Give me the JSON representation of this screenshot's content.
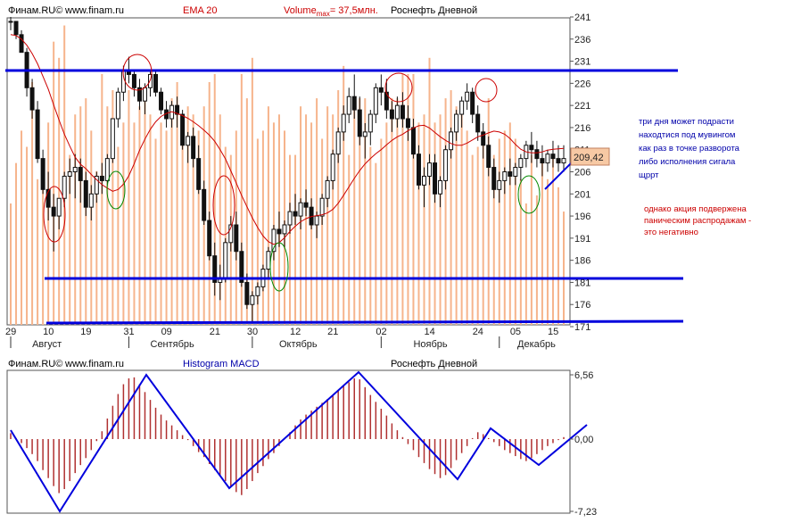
{
  "price_header": {
    "source": "Финам.RU©",
    "site": "www.finam.ru",
    "indicator": "EMA 20",
    "volume_prefix": "Volume",
    "volume_sub": "max",
    "volume_suffix": "= 37,5млн.",
    "instrument": "Роснефть Дневной"
  },
  "macd_header": {
    "source": "Финам.RU©",
    "site": "www.finam.ru",
    "indicator": "Histogram MACD",
    "instrument": "Роснефть Дневной"
  },
  "notes": {
    "blue_lines": [
      "три дня может подрасти",
      "находтися под мувингом",
      "как раз в точке разворота",
      "либо исполнения сигала",
      "щррт"
    ],
    "red_lines": [
      "однако акция подвержена",
      "паническим распродажам -",
      "это негативно"
    ]
  },
  "colors": {
    "candle": "#111111",
    "ema": "#cc0000",
    "volume": "#f6b48c",
    "macd_bar": "#b03030",
    "trend_line": "#0000dd",
    "ellipse_red": "#cc0000",
    "ellipse_green": "#008800",
    "last_price_bg": "#f7c9a4",
    "note_blue": "#0000aa",
    "note_red": "#cc0000"
  },
  "chart_data": [
    {
      "type": "candlestick",
      "title": "Роснефть Дневной",
      "ylim": [
        171,
        241
      ],
      "y_ticks": [
        "241",
        "236",
        "231",
        "226",
        "221",
        "216",
        "211",
        "206",
        "201",
        "196",
        "191",
        "186",
        "181",
        "176",
        "171"
      ],
      "x_ticks": [
        "29",
        "10",
        "19",
        "31",
        "09",
        "21",
        "30",
        "12",
        "21",
        "02",
        "14",
        "24",
        "05",
        "15"
      ],
      "months": [
        "Август",
        "Сентябрь",
        "Октябрь",
        "Ноябрь",
        "Декабрь"
      ],
      "last_price": "209,42",
      "series": [
        {
          "name": "EMA 20",
          "values": [
            237.0,
            236.8,
            236.0,
            234.6,
            232.7,
            230.4,
            227.6,
            224.7,
            221.1,
            217.7,
            214.5,
            211.8,
            209.3,
            207.7,
            206.7,
            205.4,
            204.2,
            203.1,
            202.3,
            201.6,
            202.0,
            203.2,
            205.1,
            207.8,
            210.9,
            213.4,
            215.6,
            217.3,
            218.5,
            219.2,
            219.6,
            219.2,
            218.7,
            218.1,
            217.3,
            216.4,
            215.4,
            214.3,
            212.9,
            211.0,
            208.9,
            206.2,
            203.5,
            200.7,
            198.1,
            195.6,
            193.4,
            191.5,
            190.2,
            189.6,
            190.0,
            191.1,
            192.5,
            193.7,
            194.7,
            195.4,
            195.9,
            196.1,
            196.3,
            196.7,
            197.5,
            198.9,
            200.7,
            202.6,
            204.5,
            206.3,
            207.8,
            209.0,
            210.1,
            211.0,
            212.1,
            213.1,
            213.9,
            214.5,
            215.3,
            215.9,
            216.4,
            216.5,
            215.9,
            214.9,
            213.9,
            213.1,
            212.4,
            212.0,
            212.0,
            212.5,
            213.2,
            213.9,
            214.3,
            214.8,
            215.2,
            215.0,
            214.5,
            213.5,
            212.2,
            211.1,
            210.5,
            210.3,
            210.3,
            210.5,
            210.9,
            211.1,
            211.2,
            211.3
          ]
        },
        {
          "name": "Volume",
          "values": [
            15,
            20,
            24,
            22,
            30,
            18,
            17,
            25,
            35,
            33,
            37,
            21,
            26,
            27,
            28,
            24,
            19,
            31,
            27,
            29,
            22,
            25,
            29,
            25,
            27,
            29,
            26,
            23,
            25,
            24,
            28,
            30,
            26,
            27,
            26,
            24,
            27,
            30,
            31,
            26,
            22,
            21,
            24,
            31,
            28,
            33,
            23,
            24,
            27,
            25,
            26,
            24,
            21,
            21,
            27,
            26,
            25,
            28,
            23,
            27,
            26,
            29,
            32,
            21,
            27,
            28,
            28,
            22,
            20,
            23,
            25,
            28,
            28,
            31,
            31,
            31,
            25,
            26,
            33,
            25,
            26,
            28,
            29,
            27,
            26,
            24,
            21,
            22,
            24,
            28,
            21,
            23,
            24,
            25,
            23,
            18,
            15,
            21,
            16,
            20,
            18,
            21,
            17,
            14
          ]
        }
      ],
      "candles": [
        [
          240,
          241,
          238,
          240
        ],
        [
          240,
          240,
          236,
          237
        ],
        [
          237,
          238,
          233,
          233
        ],
        [
          233,
          234,
          223,
          225
        ],
        [
          225,
          227,
          218,
          220
        ],
        [
          220,
          222,
          208,
          209
        ],
        [
          209,
          211,
          201,
          202
        ],
        [
          202,
          206,
          195,
          198
        ],
        [
          198,
          201,
          188,
          196
        ],
        [
          196,
          200,
          193,
          200
        ],
        [
          200,
          206,
          198,
          205
        ],
        [
          205,
          209,
          201,
          206
        ],
        [
          206,
          210,
          200,
          207
        ],
        [
          207,
          209,
          199,
          204
        ],
        [
          204,
          206,
          196,
          198
        ],
        [
          198,
          203,
          195,
          201
        ],
        [
          201,
          206,
          199,
          205
        ],
        [
          205,
          208,
          201,
          204
        ],
        [
          204,
          210,
          203,
          209
        ],
        [
          209,
          218,
          208,
          218
        ],
        [
          218,
          225,
          216,
          224
        ],
        [
          224,
          230,
          222,
          229
        ],
        [
          229,
          232,
          226,
          228
        ],
        [
          228,
          229,
          223,
          225
        ],
        [
          225,
          227,
          220,
          222
        ],
        [
          222,
          226,
          219,
          225
        ],
        [
          225,
          229,
          223,
          228
        ],
        [
          228,
          229,
          223,
          224
        ],
        [
          224,
          225,
          219,
          220
        ],
        [
          220,
          222,
          216,
          218
        ],
        [
          218,
          222,
          216,
          221
        ],
        [
          221,
          223,
          216,
          219
        ],
        [
          219,
          220,
          211,
          212
        ],
        [
          212,
          215,
          208,
          214
        ],
        [
          214,
          216,
          207,
          209
        ],
        [
          209,
          212,
          201,
          202
        ],
        [
          202,
          204,
          194,
          195
        ],
        [
          195,
          197,
          186,
          187
        ],
        [
          187,
          190,
          178,
          181
        ],
        [
          181,
          185,
          177,
          182
        ],
        [
          182,
          191,
          181,
          190
        ],
        [
          190,
          196,
          188,
          194
        ],
        [
          194,
          197,
          186,
          188
        ],
        [
          188,
          190,
          180,
          181
        ],
        [
          181,
          183,
          175,
          176
        ],
        [
          176,
          179,
          172,
          178
        ],
        [
          178,
          181,
          176,
          180
        ],
        [
          180,
          185,
          179,
          184
        ],
        [
          184,
          189,
          182,
          188
        ],
        [
          188,
          194,
          186,
          193
        ],
        [
          193,
          197,
          189,
          192
        ],
        [
          192,
          195,
          189,
          194
        ],
        [
          194,
          199,
          192,
          197
        ],
        [
          197,
          201,
          194,
          196
        ],
        [
          196,
          200,
          193,
          199
        ],
        [
          199,
          202,
          196,
          198
        ],
        [
          198,
          200,
          193,
          194
        ],
        [
          194,
          197,
          191,
          196
        ],
        [
          196,
          201,
          194,
          200
        ],
        [
          200,
          205,
          198,
          204
        ],
        [
          204,
          211,
          202,
          210
        ],
        [
          210,
          216,
          208,
          215
        ],
        [
          215,
          221,
          213,
          219
        ],
        [
          219,
          225,
          217,
          223
        ],
        [
          223,
          228,
          218,
          220
        ],
        [
          220,
          223,
          212,
          214
        ],
        [
          214,
          217,
          209,
          215
        ],
        [
          215,
          220,
          212,
          219
        ],
        [
          219,
          226,
          217,
          225
        ],
        [
          225,
          228,
          221,
          224
        ],
        [
          224,
          227,
          218,
          220
        ],
        [
          220,
          222,
          215,
          218
        ],
        [
          218,
          223,
          216,
          221
        ],
        [
          221,
          224,
          216,
          218
        ],
        [
          218,
          221,
          213,
          216
        ],
        [
          216,
          218,
          209,
          210
        ],
        [
          210,
          212,
          202,
          203
        ],
        [
          203,
          207,
          198,
          205
        ],
        [
          205,
          210,
          203,
          208
        ],
        [
          208,
          210,
          199,
          201
        ],
        [
          201,
          205,
          198,
          204
        ],
        [
          204,
          212,
          202,
          211
        ],
        [
          211,
          216,
          209,
          215
        ],
        [
          215,
          220,
          213,
          219
        ],
        [
          219,
          223,
          216,
          222
        ],
        [
          222,
          226,
          220,
          224
        ],
        [
          224,
          225,
          217,
          219
        ],
        [
          219,
          221,
          213,
          215
        ],
        [
          215,
          217,
          209,
          212
        ],
        [
          212,
          214,
          205,
          207
        ],
        [
          207,
          209,
          200,
          202
        ],
        [
          202,
          206,
          199,
          204
        ],
        [
          204,
          207,
          201,
          206
        ],
        [
          206,
          209,
          203,
          205
        ],
        [
          205,
          208,
          203,
          207
        ],
        [
          207,
          210,
          204,
          209
        ],
        [
          209,
          213,
          207,
          212
        ],
        [
          212,
          215,
          208,
          211
        ],
        [
          211,
          213,
          207,
          209
        ],
        [
          209,
          212,
          205,
          208
        ],
        [
          208,
          211,
          206,
          210
        ],
        [
          210,
          213,
          207,
          209
        ],
        [
          209,
          212,
          206,
          208
        ],
        [
          208,
          212,
          206,
          209
        ]
      ]
    },
    {
      "type": "bar",
      "title": "Histogram MACD",
      "ylim": [
        -7.23,
        6.56
      ],
      "y_ticks": [
        "6,56",
        "0,00",
        "-7,23"
      ],
      "values": [
        0.6,
        0.1,
        -0.4,
        -0.9,
        -1.5,
        -2.2,
        -3.1,
        -3.9,
        -4.7,
        -5.4,
        -5.0,
        -4.2,
        -3.4,
        -2.6,
        -1.9,
        -1.1,
        -0.2,
        0.8,
        2.1,
        3.4,
        4.6,
        5.6,
        6.2,
        6.3,
        5.6,
        4.8,
        4.0,
        3.2,
        2.5,
        1.9,
        1.4,
        0.9,
        0.4,
        -0.1,
        -0.7,
        -1.3,
        -1.8,
        -2.5,
        -3.1,
        -3.7,
        -4.2,
        -4.8,
        -5.3,
        -5.6,
        -5.0,
        -4.2,
        -3.4,
        -2.7,
        -2.0,
        -1.4,
        -0.7,
        0.0,
        0.7,
        1.4,
        2.0,
        2.5,
        2.9,
        3.3,
        3.7,
        4.1,
        4.5,
        5.0,
        5.4,
        5.8,
        6.2,
        6.1,
        5.3,
        4.5,
        3.8,
        3.1,
        2.4,
        1.6,
        0.9,
        0.2,
        -0.5,
        -1.1,
        -1.8,
        -2.4,
        -3.0,
        -3.5,
        -3.9,
        -3.6,
        -2.9,
        -2.1,
        -1.4,
        -0.7,
        0.1,
        0.7,
        0.5,
        0.1,
        -0.3,
        -0.7,
        -1.1,
        -1.4,
        -1.7,
        -2.0,
        -2.2,
        -1.9,
        -1.5,
        -1.1,
        -0.7,
        -0.4,
        -0.1,
        0.2
      ]
    }
  ]
}
